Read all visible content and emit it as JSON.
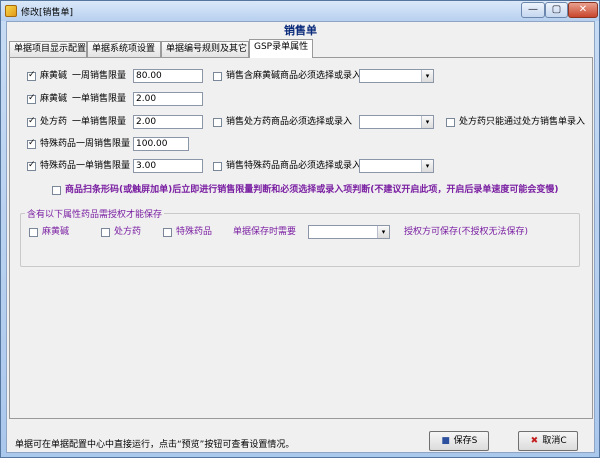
{
  "window": {
    "title": "修改[销售单]",
    "min_icon": "—",
    "max_icon": "▢",
    "close_icon": "✕"
  },
  "form_title": "销售单",
  "tabs": [
    "单据项目显示配置",
    "单据系统项设置",
    "单据编号规则及其它",
    "GSP录单属性"
  ],
  "rows": {
    "r1": {
      "checkbox_label": "麻黄碱",
      "limit_label": "一周销售限量",
      "limit_value": "80.00",
      "option_label": "销售含麻黄碱商品必须选择或录入",
      "combo_value": ""
    },
    "r2": {
      "checkbox_label": "麻黄碱",
      "limit_label": "一单销售限量",
      "limit_value": "2.00"
    },
    "r3": {
      "checkbox_label": "处方药",
      "limit_label": "一单销售限量",
      "limit_value": "2.00",
      "option_label": "销售处方药商品必须选择或录入",
      "combo_value": "",
      "extra_label": "处方药只能通过处方销售单录入"
    },
    "r4": {
      "checkbox_label": "特殊药品一周销售限量",
      "limit_value": "100.00"
    },
    "r5": {
      "checkbox_label": "特殊药品一单销售限量",
      "limit_value": "3.00",
      "option_label": "销售特殊药品商品必须选择或录入",
      "combo_value": ""
    }
  },
  "scan_option": "商品扫条形码(或触屏加单)后立即进行销售限量判断和必须选择或录入项判断(不建议开启此项，开启后录单速度可能会变慢)",
  "auth_group": {
    "title": "含有以下属性药品需授权才能保存",
    "items": [
      "麻黄碱",
      "处方药",
      "特殊药品"
    ],
    "time_label": "单据保存时需要",
    "time_value": "",
    "note": "授权方可保存(不授权无法保存)"
  },
  "footer": {
    "hint": "单据可在单据配置中心中直接运行，点击“预览”按钮可查看设置情况。",
    "save_label": "保存S",
    "cancel_label": "取消C"
  },
  "icons": {
    "save": "floppy-disk-icon",
    "cancel": "close-x-icon",
    "combo_arrow": "▾"
  },
  "colors": {
    "purple": "#7a1fa2",
    "title_blue": "#0a2a7a"
  }
}
